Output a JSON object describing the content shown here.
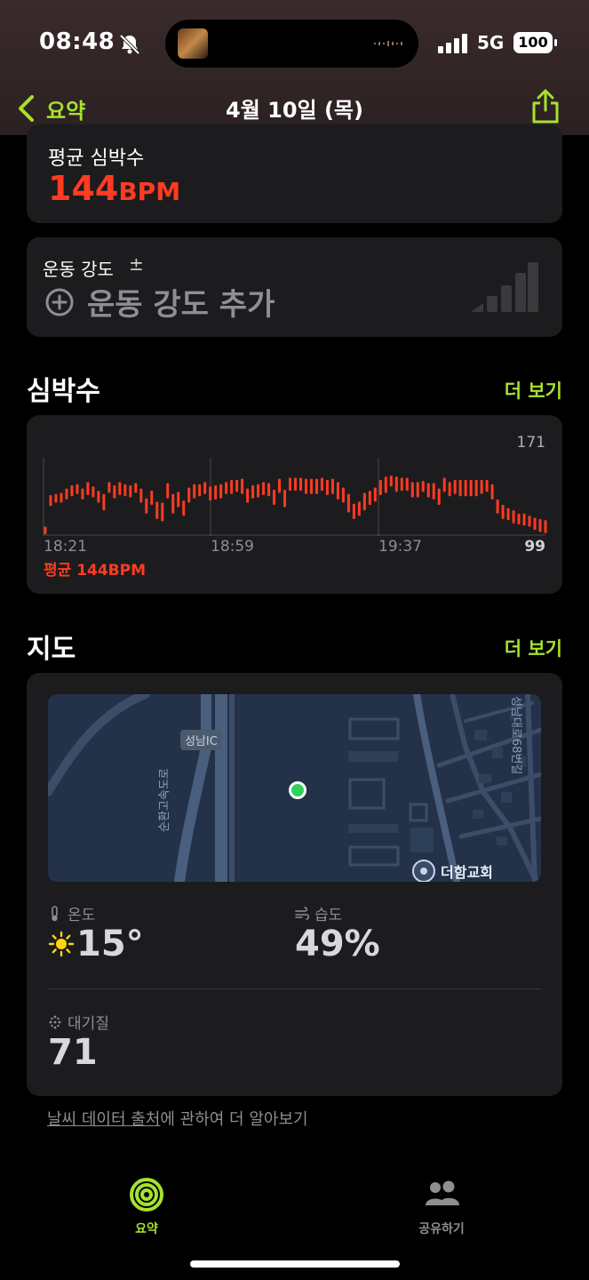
{
  "status": {
    "time": "08:48",
    "network": "5G",
    "battery": "100"
  },
  "nav": {
    "back_label": "요약",
    "title": "4월 10일 (목)"
  },
  "avg_heart_rate": {
    "label": "평균 심박수",
    "value": "144",
    "unit": "BPM"
  },
  "effort": {
    "label": "운동 강도",
    "plus_minus": "±",
    "add_label": "운동 강도 추가"
  },
  "heart_rate_section": {
    "title": "심박수",
    "more": "더 보기",
    "avg_label": "평균 144BPM"
  },
  "chart_data": {
    "type": "bar",
    "title": "",
    "x_ticks": [
      "18:21",
      "18:59",
      "19:37"
    ],
    "ymax_label": "171",
    "ymin_label": "99",
    "ylim": [
      99,
      171
    ],
    "ranges": [
      [
        99,
        106
      ],
      [
        125,
        135
      ],
      [
        128,
        136
      ],
      [
        128,
        137
      ],
      [
        131,
        141
      ],
      [
        134,
        144
      ],
      [
        136,
        145
      ],
      [
        131,
        141
      ],
      [
        135,
        147
      ],
      [
        133,
        143
      ],
      [
        128,
        139
      ],
      [
        121,
        136
      ],
      [
        137,
        147
      ],
      [
        132,
        144
      ],
      [
        135,
        147
      ],
      [
        134,
        145
      ],
      [
        133,
        144
      ],
      [
        137,
        146
      ],
      [
        128,
        141
      ],
      [
        118,
        132
      ],
      [
        126,
        139
      ],
      [
        113,
        129
      ],
      [
        111,
        128
      ],
      [
        132,
        146
      ],
      [
        118,
        136
      ],
      [
        124,
        138
      ],
      [
        116,
        130
      ],
      [
        128,
        142
      ],
      [
        132,
        145
      ],
      [
        134,
        145
      ],
      [
        136,
        147
      ],
      [
        130,
        143
      ],
      [
        131,
        144
      ],
      [
        132,
        145
      ],
      [
        136,
        147
      ],
      [
        136,
        149
      ],
      [
        138,
        149
      ],
      [
        136,
        150
      ],
      [
        128,
        141
      ],
      [
        132,
        144
      ],
      [
        133,
        145
      ],
      [
        135,
        147
      ],
      [
        134,
        146
      ],
      [
        126,
        140
      ],
      [
        137,
        150
      ],
      [
        124,
        140
      ],
      [
        139,
        151
      ],
      [
        139,
        151
      ],
      [
        139,
        151
      ],
      [
        136,
        150
      ],
      [
        136,
        150
      ],
      [
        136,
        150
      ],
      [
        139,
        151
      ],
      [
        135,
        149
      ],
      [
        136,
        150
      ],
      [
        131,
        147
      ],
      [
        128,
        142
      ],
      [
        119,
        136
      ],
      [
        113,
        127
      ],
      [
        116,
        129
      ],
      [
        121,
        137
      ],
      [
        126,
        139
      ],
      [
        129,
        142
      ],
      [
        135,
        149
      ],
      [
        137,
        152
      ],
      [
        143,
        153
      ],
      [
        138,
        152
      ],
      [
        139,
        151
      ],
      [
        139,
        151
      ],
      [
        133,
        147
      ],
      [
        133,
        147
      ],
      [
        138,
        148
      ],
      [
        133,
        146
      ],
      [
        131,
        146
      ],
      [
        126,
        141
      ],
      [
        138,
        151
      ],
      [
        134,
        147
      ],
      [
        136,
        149
      ],
      [
        134,
        149
      ],
      [
        134,
        149
      ],
      [
        134,
        149
      ],
      [
        134,
        149
      ],
      [
        136,
        149
      ],
      [
        138,
        149
      ],
      [
        131,
        145
      ],
      [
        118,
        131
      ],
      [
        113,
        126
      ],
      [
        112,
        123
      ],
      [
        109,
        121
      ],
      [
        108,
        118
      ],
      [
        107,
        118
      ],
      [
        106,
        116
      ],
      [
        103,
        114
      ],
      [
        101,
        113
      ],
      [
        100,
        112
      ]
    ]
  },
  "map_section": {
    "title": "지도",
    "more": "더 보기",
    "labels": {
      "interchange": "성남IC",
      "road": "순환고속도로",
      "road2": "성남대로68번길",
      "poi": "더함교회"
    }
  },
  "weather": {
    "temp_label": "온도",
    "temp_value": "15°",
    "humidity_label": "습도",
    "humidity_value": "49%",
    "aqi_label": "대기질",
    "aqi_value": "71"
  },
  "footnote": {
    "link": "날씨 데이터 출처",
    "rest": "에 관하여 더 알아보기"
  },
  "tabbar": {
    "summary": "요약",
    "sharing": "공유하기"
  },
  "colors": {
    "accent": "#a6e22e",
    "heart": "#ff3b22",
    "card": "#1c1c1e"
  }
}
